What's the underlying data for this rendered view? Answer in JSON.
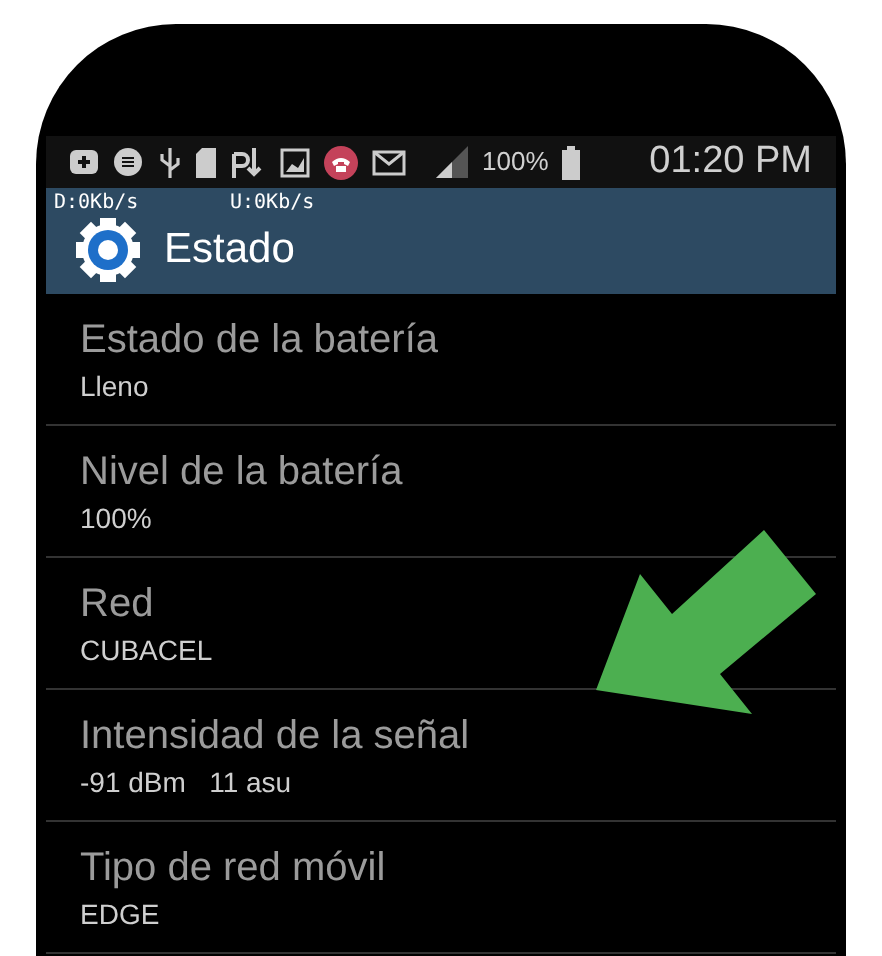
{
  "status_bar": {
    "battery": "100%",
    "time": "01:20 PM"
  },
  "speed": {
    "download": "D:0Kb/s",
    "upload": "U:0Kb/s"
  },
  "action_bar": {
    "title": "Estado"
  },
  "items": [
    {
      "title": "Estado de la batería",
      "value": "Lleno"
    },
    {
      "title": "Nivel de la batería",
      "value": "100%"
    },
    {
      "title": "Red",
      "value": "CUBACEL"
    },
    {
      "title": "Intensidad de la señal",
      "value": "-91 dBm   11 asu"
    },
    {
      "title": "Tipo de red móvil",
      "value": "EDGE"
    }
  ]
}
